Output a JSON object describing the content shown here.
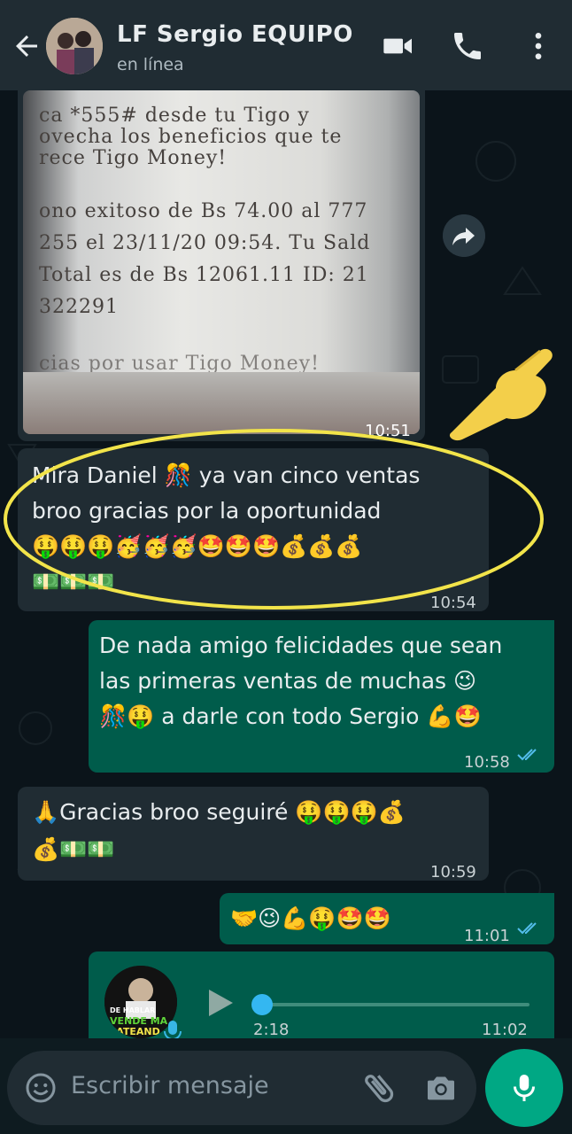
{
  "header": {
    "title": "LF Sergio EQUIPO",
    "status": "en línea"
  },
  "receipt": {
    "lines": [
      "ca *555#  desde  tu  Tigo  y",
      "ovecha los beneficios que te",
      "rece Tigo Money!",
      "ono exitoso de Bs 74.00 al 777",
      "255 el 23/11/20 09:54. Tu Sald",
      "Total es de Bs 12061.11 ID: 21",
      "322291",
      "cias  por  usar  Tigo  Money!"
    ],
    "time": "10:51"
  },
  "messages": [
    {
      "line1": "Mira Daniel 🎊 ya van cinco ventas",
      "line2": "broo gracias por la oportunidad",
      "line3": "🤑🤑🤑🥳🥳🥳🤩🤩🤩💰💰💰",
      "line4": "💵💵💵",
      "time": "10:54"
    },
    {
      "line1": "De nada amigo felicidades que sean",
      "line2": "las primeras ventas de muchas 😉",
      "line3": "🎊🤑 a darle con todo Sergio 💪🤩",
      "time": "10:58"
    },
    {
      "line1": "🙏Gracias broo seguiré 🤑🤑🤑💰",
      "line2": "💰💵💵",
      "time": "10:59"
    },
    {
      "line1": "🤝😉💪🤑🤩🤩",
      "time": "11:01"
    }
  ],
  "audio": {
    "duration": "2:18",
    "time": "11:02",
    "progress": 0,
    "thumb_text_1": "DE HABLAR",
    "thumb_text_2": "VENDE MA",
    "thumb_text_3": "HATEAND"
  },
  "composer": {
    "placeholder": "Escribir mensaje"
  },
  "colors": {
    "accent": "#00a884",
    "outgoing": "#005c4b",
    "incoming": "#202c33",
    "highlight": "#f2e44a"
  }
}
